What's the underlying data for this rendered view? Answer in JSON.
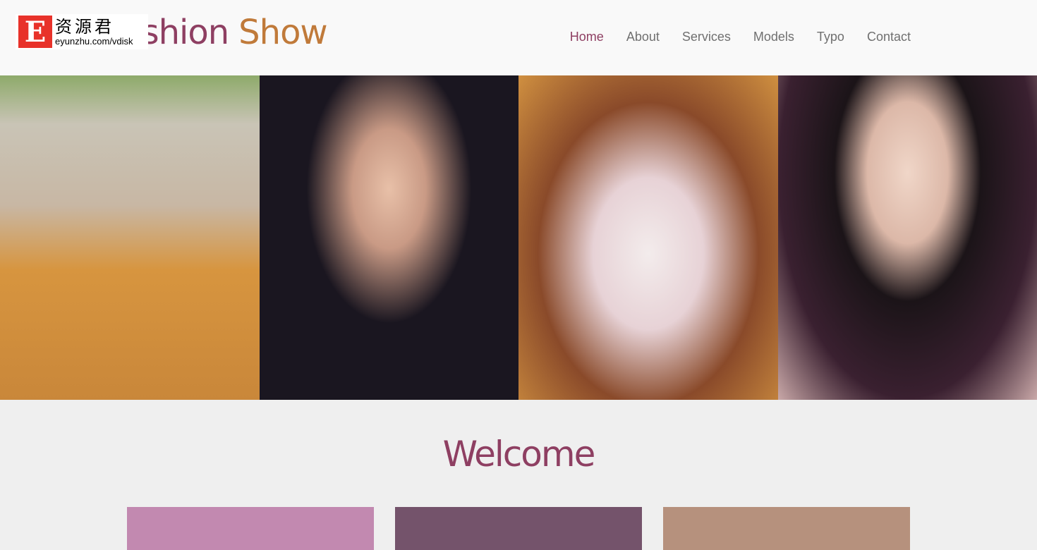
{
  "header": {
    "brand_part1": "Fashion",
    "brand_part2": "Show"
  },
  "watermark": {
    "letter": "E",
    "chinese": "资源君",
    "url": "eyunzhu.com/vdisk"
  },
  "nav": {
    "items": [
      {
        "label": "Home",
        "active": true
      },
      {
        "label": "About"
      },
      {
        "label": "Services"
      },
      {
        "label": "Models"
      },
      {
        "label": "Typo"
      },
      {
        "label": "Contact"
      }
    ]
  },
  "gallery": {
    "photos": [
      "model-1",
      "model-2",
      "model-3",
      "model-4"
    ]
  },
  "main": {
    "title": "Welcome"
  },
  "colors": {
    "accent": "#8e3f62",
    "brand2": "#c07a3a",
    "box1": "#c289b0",
    "box2": "#74536b",
    "box3": "#b6917d"
  }
}
